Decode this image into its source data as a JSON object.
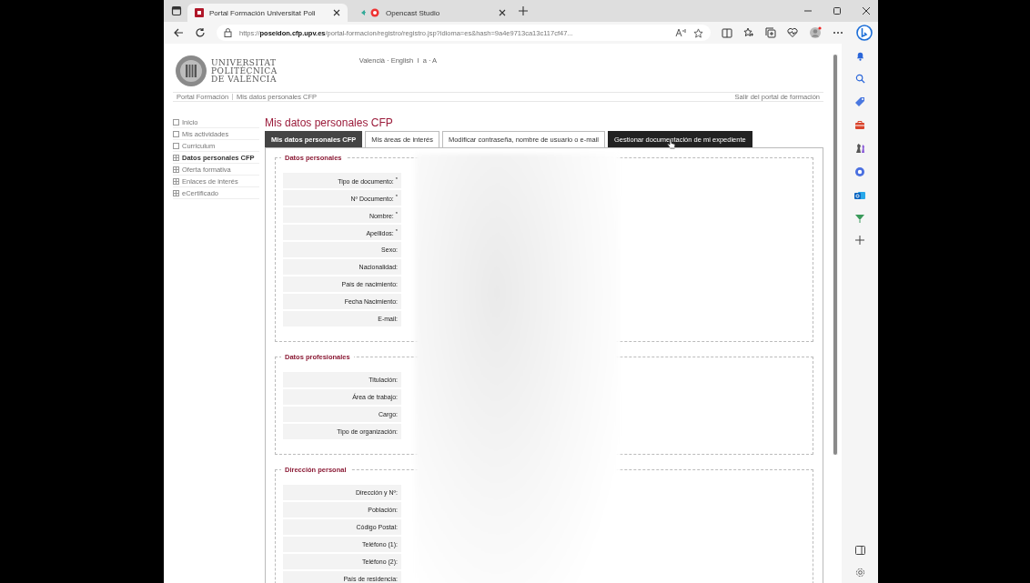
{
  "browser": {
    "tabs": [
      {
        "title": "Portal Formación Universitat Poli",
        "selected": true
      },
      {
        "title": "Opencast Studio",
        "selected": false
      }
    ],
    "address": "https://**poseidon.cfp.upv.es**/portal-formacion/registro/registro.jsp?idioma=es&hash=9a4e9713ca13c117cf47..."
  },
  "header": {
    "logo_lines": [
      "UNIVERSITAT",
      "POLITÈCNICA",
      "DE VALÈNCIA"
    ],
    "language_links": "Valencià · English  I  a · A"
  },
  "breadcrumb": {
    "items": [
      "Portal Formación",
      "Mis datos personales CFP"
    ],
    "exit_link": "Salir del portal de formación"
  },
  "sidebar": {
    "items": [
      {
        "label": "Inicio",
        "kind": "page",
        "selected": false
      },
      {
        "label": "Mis actividades",
        "kind": "page",
        "selected": false
      },
      {
        "label": "Curriculum",
        "kind": "page",
        "selected": false
      },
      {
        "label": "Datos personales CFP",
        "kind": "grid",
        "selected": true
      },
      {
        "label": "Oferta formativa",
        "kind": "grid",
        "selected": false
      },
      {
        "label": "Enlaces de interés",
        "kind": "grid",
        "selected": false
      },
      {
        "label": "eCertificado",
        "kind": "grid",
        "selected": false
      }
    ]
  },
  "page_title": "Mis datos personales CFP",
  "tabs": [
    {
      "label": "Mis datos personales CFP",
      "selected": true,
      "hovered": false
    },
    {
      "label": "Mis áreas de interés",
      "selected": false,
      "hovered": false
    },
    {
      "label": "Modificar contraseña, nombre de usuario o e-mail",
      "selected": false,
      "hovered": false
    },
    {
      "label": "Gestionar documentación de mi expediente",
      "selected": false,
      "hovered": true
    }
  ],
  "sections": [
    {
      "title": "Datos personales",
      "fields": [
        "Tipo de documento: $^{*}$",
        "Nº Documento: $^{*}$",
        "Nombre: $^{*}$",
        "Apellidos: $^{*}$",
        "Sexo:",
        "Nacionalidad:",
        "País de nacimiento:",
        "Fecha Nacimiento:",
        "E-mail:"
      ]
    },
    {
      "title": "Datos profesionales",
      "fields": [
        "Titulación:",
        "Área de trabajo:",
        "Cargo:",
        "Tipo de organización:"
      ]
    },
    {
      "title": "Dirección personal",
      "fields": [
        "Dirección y Nº:",
        "Población:",
        "Código Postal:",
        "Teléfono (1):",
        "Teléfono (2):",
        "País de residencia:"
      ]
    }
  ]
}
